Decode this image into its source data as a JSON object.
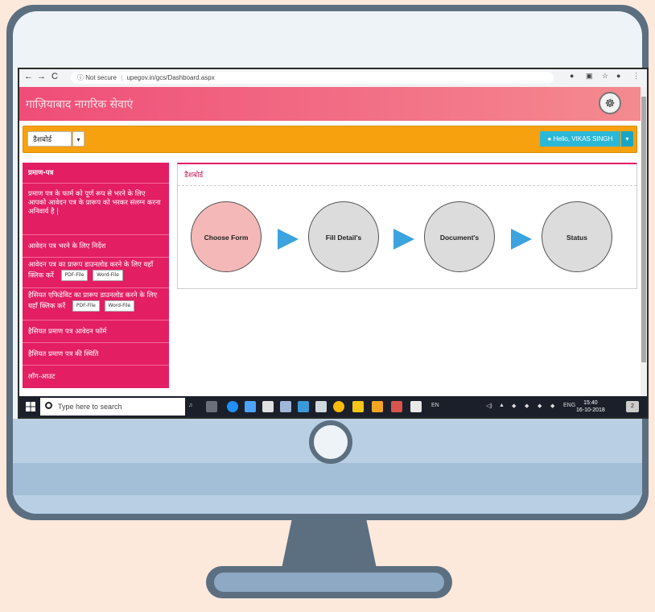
{
  "browser": {
    "back": "←",
    "forward": "→",
    "reload": "C",
    "security_label": "ⓘ Not secure",
    "separator": "|",
    "url": "upegov.in/gcs/Dashboard.aspx"
  },
  "site": {
    "title": "गाज़ियाबाद नागरिक सेवाएं"
  },
  "toolbar": {
    "dashboard_label": "डैशबोर्ड",
    "user_label": "Hello, VIKAS SINGH"
  },
  "sidebar": {
    "items": [
      {
        "label": "प्रमाण-पत्र"
      },
      {
        "label": "प्रमाण पत्र के फार्म को पूर्ण रूप से भरने के लिए आपको आवेदन पत्र के प्रारूप को भरकर संलग्न करना अनिवार्य है |"
      },
      {
        "label": "आवेदन पत्र भरने के लिए निर्देश"
      },
      {
        "label": "आवेदन पत्र का प्रारूप डाउनलोड करने के लिए यहाँ क्लिक करें",
        "pdf": "PDF-File",
        "word": "Word-File"
      },
      {
        "label": "हैसियत एफिडेविट का प्रारूप डाउनलोड करने के लिए यहाँ क्लिक करें",
        "pdf": "PDF-File",
        "word": "Word-File"
      },
      {
        "label": "हैसियत प्रमाण पत्र आवेदन फॉर्म"
      },
      {
        "label": "हैसियत प्रमाण पत्र की स्थिति"
      },
      {
        "label": "लॉग-आउट"
      }
    ]
  },
  "panel": {
    "title": "डैशबोर्ड",
    "steps": [
      {
        "label": "Choose Form",
        "color": "#f5b8b8"
      },
      {
        "label": "Fill Detail's",
        "color": "#dcdcdc"
      },
      {
        "label": "Document's",
        "color": "#dcdcdc"
      },
      {
        "label": "Status",
        "color": "#dcdcdc"
      }
    ]
  },
  "taskbar": {
    "search_placeholder": "Type here to search",
    "lang": "EN",
    "tray_lang": "ENG",
    "time": "15:40",
    "date": "16-10-2018",
    "notification_count": "2"
  },
  "colors": {
    "accent": "#e31e62",
    "toolbar": "#f6a10d",
    "user_button": "#2bb8d6",
    "arrow": "#3ba3de"
  }
}
